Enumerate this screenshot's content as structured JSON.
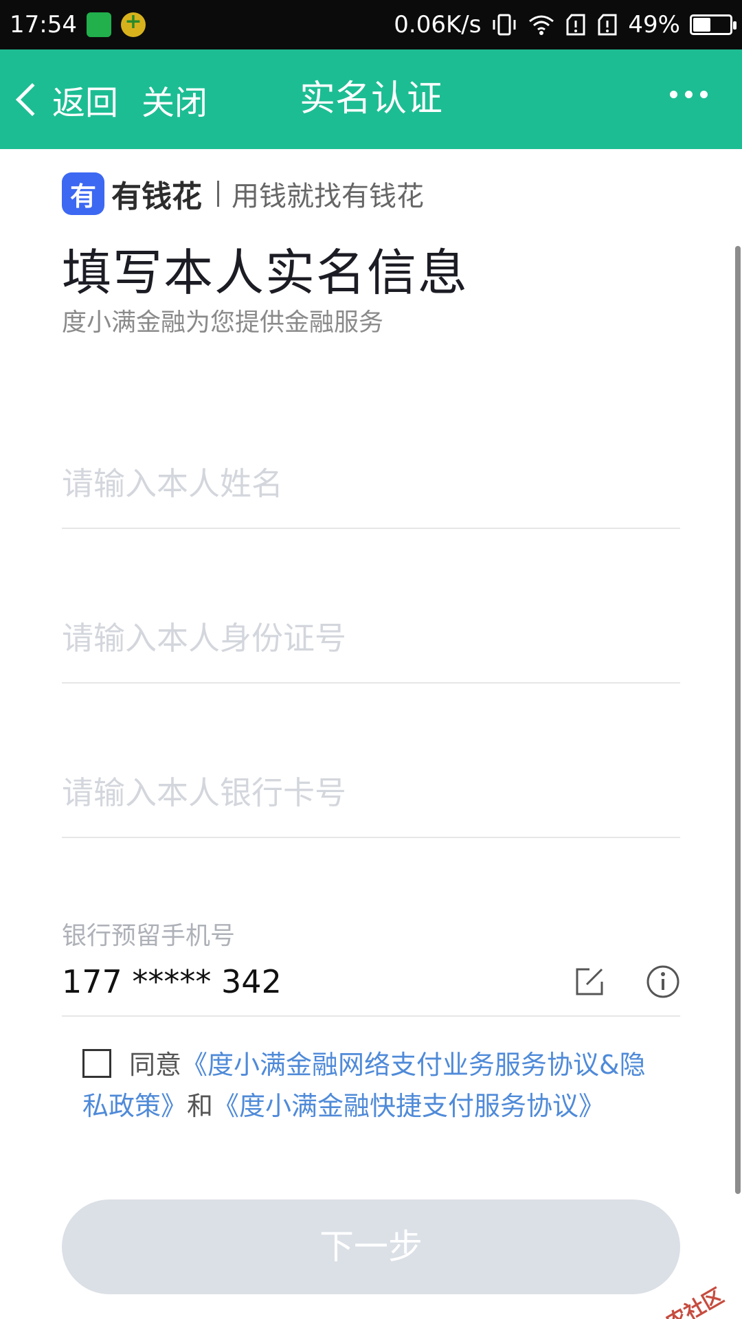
{
  "status_bar": {
    "time": "17:54",
    "net_speed": "0.06K/s",
    "battery": "49%",
    "battery_level": 0.49
  },
  "nav": {
    "back_label": "返回",
    "close_label": "关闭",
    "title": "实名认证",
    "bg_color": "#1dbd93"
  },
  "brand": {
    "logo_char": "有",
    "name": "有钱花",
    "slogan": "用钱就找有钱花",
    "logo_color": "#3c68f2"
  },
  "form": {
    "title": "填写本人实名信息",
    "subtitle": "度小满金融为您提供金融服务",
    "name_placeholder": "请输入本人姓名",
    "id_placeholder": "请输入本人身份证号",
    "card_placeholder": "请输入本人银行卡号",
    "phone_label": "银行预留手机号",
    "phone_value": "177 ***** 342"
  },
  "agreement": {
    "prefix": "同意",
    "link1": "《度小满金融网络支付业务服务协议&隐私政策》",
    "joiner": "和",
    "link2": "《度小满金融快捷支付服务协议》",
    "checked": false
  },
  "next_button": "下一步",
  "watermark": "卡农社区"
}
